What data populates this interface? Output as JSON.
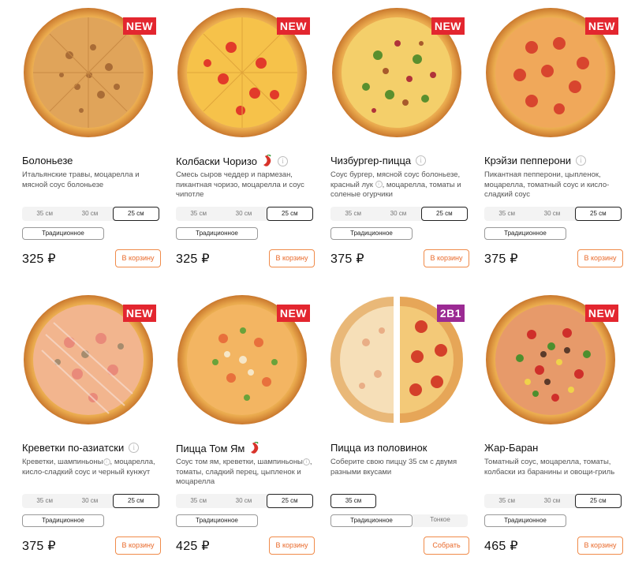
{
  "colors": {
    "accent": "#e9692a",
    "badge_new": "#e3262f",
    "badge_promo": "#9b2a93"
  },
  "pizzas": [
    {
      "badge": "NEW",
      "name": "Болоньезе",
      "spicy": false,
      "desc": "Итальянские травы, моцарелла и мясной соус болоньезе",
      "sizes": [
        "35 см",
        "30 см",
        "25 см"
      ],
      "dough": "Традиционное",
      "price": "325 ₽",
      "button": "В корзину"
    },
    {
      "badge": "NEW",
      "name": "Колбаски Чоризо",
      "spicy": true,
      "desc": "Смесь сыров чеддер и пармезан, пикантная чоризо, моцарелла и соус чипотле",
      "sizes": [
        "35 см",
        "30 см",
        "25 см"
      ],
      "dough": "Традиционное",
      "price": "325 ₽",
      "button": "В корзину"
    },
    {
      "badge": "NEW",
      "name": "Чизбургер-пицца",
      "spicy": false,
      "desc_a": "Соус бургер, мясной соус болоньезе, красный лук",
      "desc_b": ", моцарелла, томаты и соленые огурчики",
      "sizes": [
        "35 см",
        "30 см",
        "25 см"
      ],
      "dough": "Традиционное",
      "price": "375 ₽",
      "button": "В корзину"
    },
    {
      "badge": "NEW",
      "name": "Крэйзи пепперони",
      "spicy": false,
      "desc": "Пикантная пепперони, цыпленок, моцарелла, томатный соус и кисло-сладкий соус",
      "sizes": [
        "35 см",
        "30 см",
        "25 см"
      ],
      "dough": "Традиционное",
      "price": "375 ₽",
      "button": "В корзину"
    },
    {
      "badge": "NEW",
      "name": "Креветки по-азиатски",
      "spicy": false,
      "desc_a": "Креветки, шампиньоны",
      "desc_b": ", моцарелла, кисло-сладкий соус и черный кунжут",
      "sizes": [
        "35 см",
        "30 см",
        "25 см"
      ],
      "dough": "Традиционное",
      "price": "375 ₽",
      "button": "В корзину"
    },
    {
      "badge": "NEW",
      "name": "Пицца Том Ям",
      "spicy": true,
      "desc_a": "Соус том ям, креветки, шампиньоны",
      "desc_b": ", томаты, сладкий перец, цыпленок и моцарелла",
      "sizes": [
        "35 см",
        "30 см",
        "25 см"
      ],
      "dough": "Традиционное",
      "price": "425 ₽",
      "button": "В корзину"
    },
    {
      "badge": "2В1",
      "name": "Пицца из половинок",
      "spicy": false,
      "desc": "Соберите свою пиццу 35 см с двумя разными вкусами",
      "size_single": "35 см",
      "dough": "Традиционное",
      "dough_alt": "Тонкое",
      "button": "Собрать"
    },
    {
      "badge": "NEW",
      "name": "Жар-Баран",
      "spicy": false,
      "desc": "Томатный соус, моцарелла, томаты, колбаски из баранины и овощи-гриль",
      "sizes": [
        "35 см",
        "30 см",
        "25 см"
      ],
      "dough": "Традиционное",
      "price": "465 ₽",
      "button": "В корзину"
    }
  ],
  "icons": {
    "info": "info-icon",
    "spicy": "chili-icon"
  },
  "info_glyph": "i"
}
